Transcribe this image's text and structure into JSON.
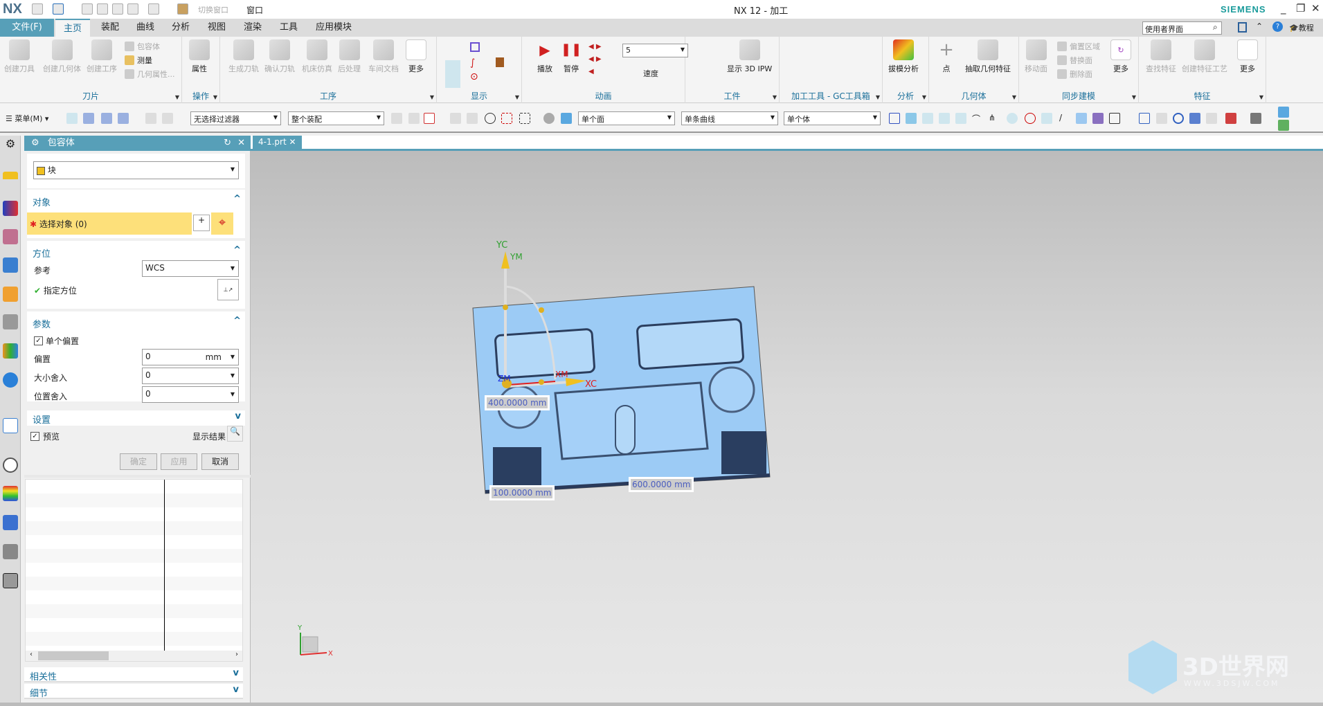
{
  "titlebar": {
    "logo": "NX",
    "switch_window": "切换窗口",
    "window_menu": "窗口",
    "title": "NX 12 - 加工",
    "brand": "SIEMENS"
  },
  "menubar": {
    "tabs": [
      "文件(F)",
      "主页",
      "装配",
      "曲线",
      "分析",
      "视图",
      "渲染",
      "工具",
      "应用模块"
    ],
    "active": "主页",
    "search_value": "使用者界面",
    "tutorial": "教程"
  },
  "ribbon": {
    "groups": [
      {
        "label": "刀片",
        "items": [
          "创建刀具",
          "创建几何体",
          "创建工序"
        ],
        "small": [
          "包容体",
          "测量",
          "几何属性..."
        ]
      },
      {
        "label": "操作",
        "items": [
          "属性"
        ]
      },
      {
        "label": "工序",
        "items": [
          "生成刀轨",
          "确认刀轨",
          "机床仿真",
          "后处理",
          "车间文档",
          "更多"
        ]
      },
      {
        "label": "显示"
      },
      {
        "label": "动画",
        "items": [
          "播放",
          "暂停"
        ],
        "speed_label": "速度",
        "speed_value": "5"
      },
      {
        "label": "工件",
        "items": [
          "显示 3D IPW"
        ]
      },
      {
        "label": "加工工具 - GC工具箱"
      },
      {
        "label": "分析",
        "items": [
          "拔模分析"
        ]
      },
      {
        "label": "几何体",
        "items": [
          "点",
          "抽取几何特征"
        ]
      },
      {
        "label": "同步建模",
        "items": [
          "移动面",
          "更多"
        ],
        "small": [
          "偏置区域",
          "替换面",
          "删除面"
        ]
      },
      {
        "label": "特征",
        "items": [
          "查找特征",
          "创建特征工艺",
          "更多"
        ]
      }
    ]
  },
  "toolbar2": {
    "menu": "菜单(M)",
    "filter": "无选择过滤器",
    "assembly": "整个装配",
    "face_rule": "单个面",
    "curve_rule": "单条曲线",
    "body_rule": "单个体"
  },
  "dialog": {
    "title": "包容体",
    "type": "块",
    "object": {
      "header": "对象",
      "select": "选择对象 (0)"
    },
    "orientation": {
      "header": "方位",
      "ref_label": "参考",
      "ref_value": "WCS",
      "specify": "指定方位"
    },
    "params": {
      "header": "参数",
      "single_offset": "单个偏置",
      "single_offset_checked": true,
      "offset_label": "偏置",
      "offset_value": "0",
      "offset_unit": "mm",
      "size_round_label": "大小舍入",
      "size_round_value": "0",
      "pos_round_label": "位置舍入",
      "pos_round_value": "0"
    },
    "settings": {
      "header": "设置"
    },
    "preview": "预览",
    "preview_checked": true,
    "show_result": "显示结果",
    "ok": "确定",
    "apply": "应用",
    "cancel": "取消",
    "dependency": "相关性",
    "details": "细节"
  },
  "document_tab": "4-1.prt",
  "viewport": {
    "labels": {
      "yc": "YC",
      "ym": "YM",
      "xm": "XM",
      "xc": "XC",
      "zm": "ZM"
    },
    "dims": [
      "400.0000 mm",
      "600.0000 mm",
      "100.0000 mm"
    ],
    "triad": {
      "x": "X",
      "y": "Y"
    },
    "watermark": {
      "name": "3D世界网",
      "url": "WWW.3DSJW.COM"
    }
  },
  "colors": {
    "accent": "#579fb8",
    "part": "#9ccbf5",
    "highlight": "#fde07a"
  }
}
